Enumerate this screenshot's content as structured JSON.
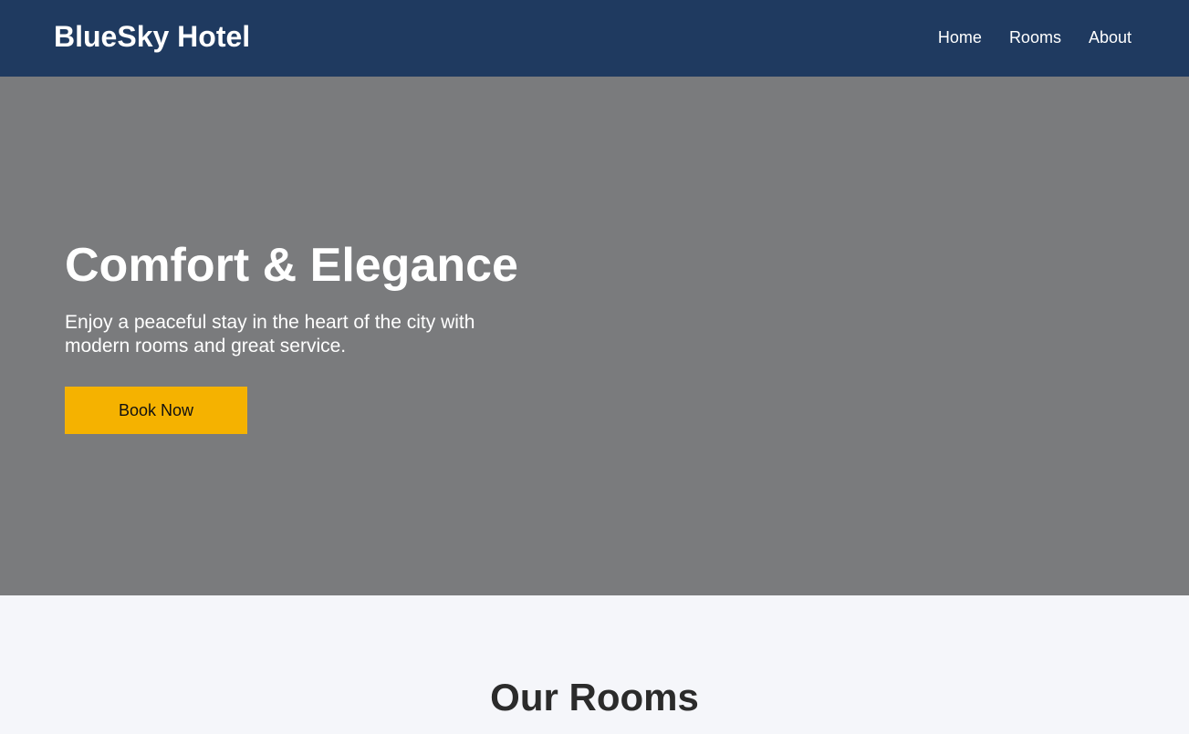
{
  "header": {
    "brand": "BlueSky Hotel",
    "nav": [
      {
        "label": "Home"
      },
      {
        "label": "Rooms"
      },
      {
        "label": "About"
      }
    ]
  },
  "hero": {
    "title": "Comfort & Elegance",
    "text": "Enjoy a peaceful stay in the heart of the city with modern rooms and great service.",
    "cta_label": "Book Now"
  },
  "rooms": {
    "title": "Our Rooms"
  },
  "colors": {
    "header_bg": "#1f3a60",
    "hero_bg": "#7a7b7d",
    "accent": "#f5b200",
    "page_bg": "#f5f6fa"
  }
}
